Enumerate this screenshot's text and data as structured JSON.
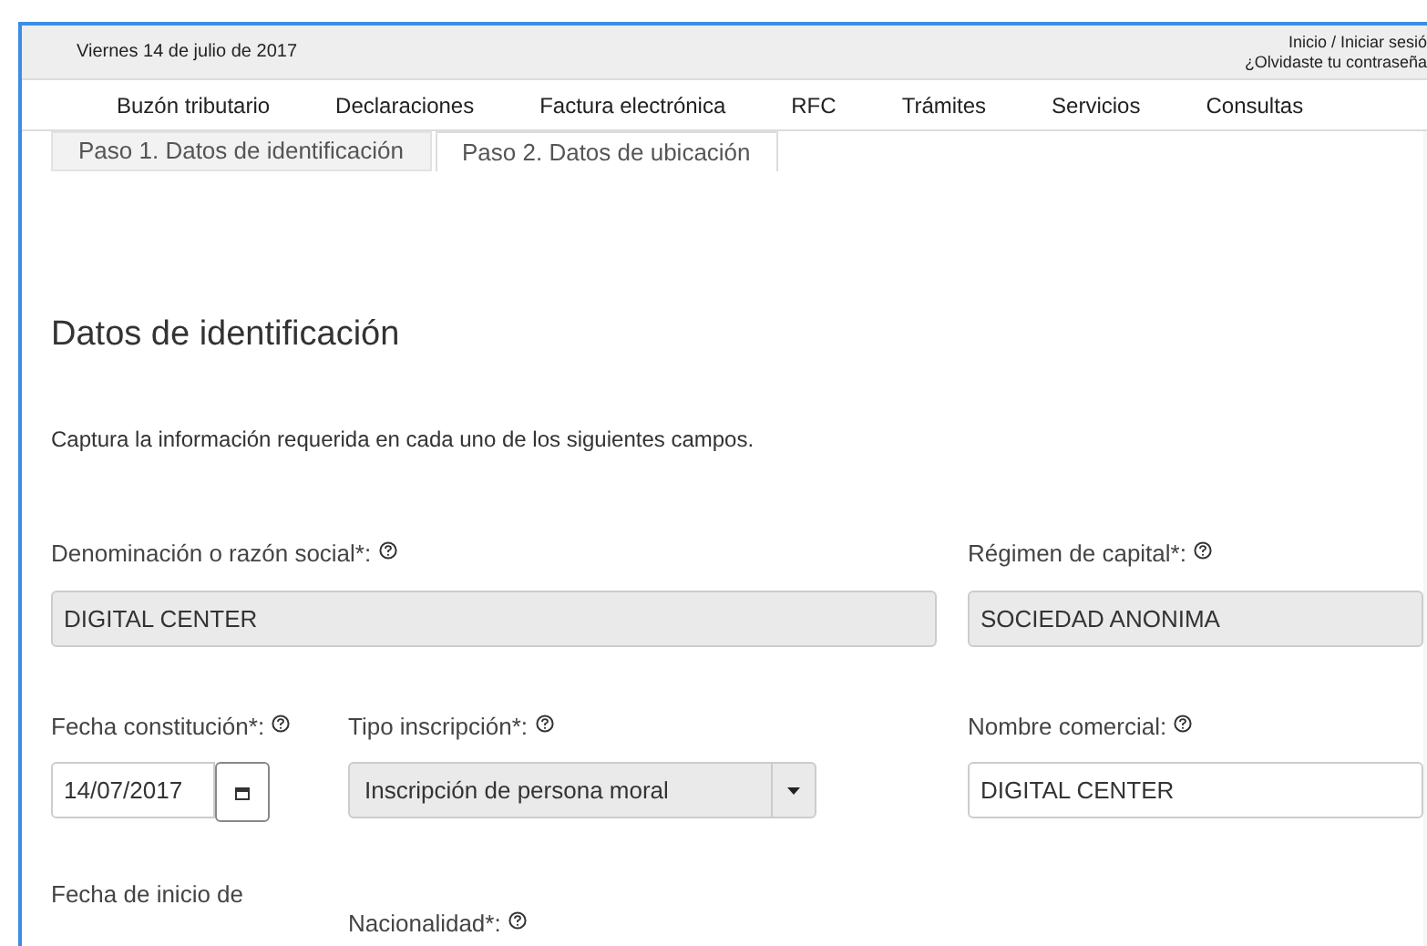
{
  "top_bar": {
    "date": "Viernes 14 de julio de 2017",
    "login_link": "Inicio / Iniciar sesió",
    "forgot_link": "¿Olvidaste tu contraseña"
  },
  "nav": [
    {
      "label": "Buzón tributario"
    },
    {
      "label": "Declaraciones"
    },
    {
      "label": "Factura electrónica"
    },
    {
      "label": "RFC"
    },
    {
      "label": "Trámites"
    },
    {
      "label": "Servicios"
    },
    {
      "label": "Consultas"
    }
  ],
  "tabs": [
    {
      "label": "Paso 1. Datos de identificación",
      "selected": false
    },
    {
      "label": "Paso 2. Datos de ubicación",
      "selected": true
    }
  ],
  "heading": "Datos de identificación",
  "instructions": "Captura la información requerida en cada uno de los siguientes campos.",
  "fields": {
    "denominacion": {
      "label": "Denominación o razón social*:",
      "value": "DIGITAL CENTER",
      "readonly": true
    },
    "regimen": {
      "label": "Régimen de capital*:",
      "value": "SOCIEDAD ANONIMA",
      "readonly": true
    },
    "fecha": {
      "label": "Fecha constitución*:",
      "value": "14/07/2017",
      "readonly": false
    },
    "tipo": {
      "label": "Tipo inscripción*:",
      "value": "Inscripción de persona moral",
      "readonly": true
    },
    "nombre": {
      "label": "Nombre comercial:",
      "value": "DIGITAL CENTER",
      "readonly": false
    },
    "fecha_inicio": {
      "label": "Fecha de inicio de"
    },
    "nacionalidad": {
      "label": "Nacionalidad*:"
    }
  }
}
